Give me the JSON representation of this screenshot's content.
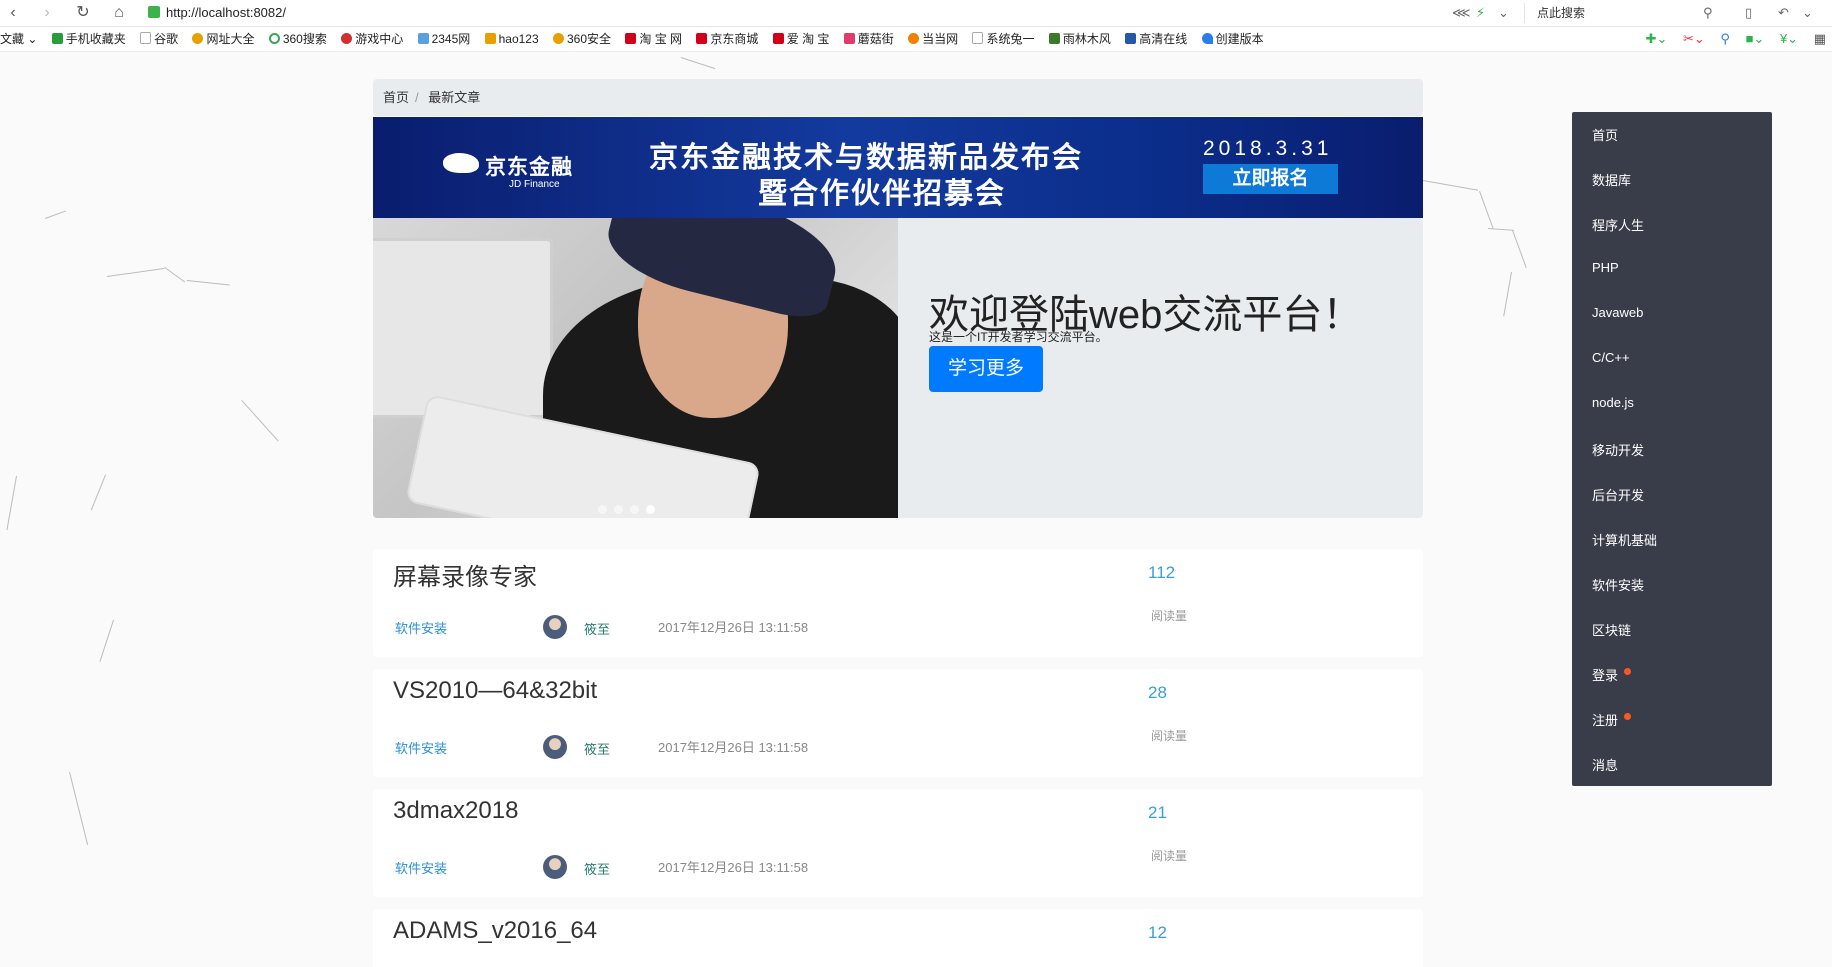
{
  "browser": {
    "url": "http://localhost:8082/",
    "search_placeholder": "点此搜索",
    "bookmarks": [
      "文藏",
      "手机收藏夹",
      "谷歌",
      "网址大全",
      "360搜索",
      "游戏中心",
      "2345网",
      "hao123",
      "360安全",
      "淘 宝 网",
      "京东商城",
      "爱 淘 宝",
      "蘑菇街",
      "当当网",
      "系统兔一",
      "雨林木风",
      "高清在线",
      "创建版本"
    ],
    "bookmark_colors": [
      "#c00",
      "#2a9d3b",
      "#999",
      "#e6a100",
      "#36a852",
      "#d32f2f",
      "#5aa0e0",
      "#e8a000",
      "#e6a100",
      "#d0021b",
      "#d0021b",
      "#d0021b",
      "#e03a6e",
      "#f08000",
      "#999",
      "#3a7a2a",
      "#2457a8",
      "#2b7de9"
    ]
  },
  "breadcrumb": {
    "home": "首页",
    "current": "最新文章"
  },
  "banner": {
    "logo": "京东金融",
    "logo_en": "JD Finance",
    "line1": "京东金融技术与数据新品发布会",
    "line2": "暨合作伙伴招募会",
    "date": "2018.3.31",
    "button": "立即报名"
  },
  "hero": {
    "title": "欢迎登陆web交流平台！",
    "subtitle": "这是一个IT开发者学习交流平台。",
    "button": "学习更多"
  },
  "articles": [
    {
      "title": "屏幕录像专家",
      "category": "软件安装",
      "author": "筱至",
      "time": "2017年12月26日 13:11:58",
      "reads": "112",
      "reads_label": "阅读量"
    },
    {
      "title": "VS2010—64&32bit",
      "category": "软件安装",
      "author": "筱至",
      "time": "2017年12月26日 13:11:58",
      "reads": "28",
      "reads_label": "阅读量"
    },
    {
      "title": "3dmax2018",
      "category": "软件安装",
      "author": "筱至",
      "time": "2017年12月26日 13:11:58",
      "reads": "21",
      "reads_label": "阅读量"
    },
    {
      "title": "ADAMS_v2016_64",
      "category": "",
      "author": "",
      "time": "",
      "reads": "12",
      "reads_label": ""
    }
  ],
  "sidebar": {
    "items": [
      "首页",
      "数据库",
      "程序人生",
      "PHP",
      "Javaweb",
      "C/C++",
      "node.js",
      "移动开发",
      "后台开发",
      "计算机基础",
      "软件安装",
      "区块链",
      "登录",
      "注册",
      "消息"
    ],
    "badge_color": "#ff5722",
    "bg_color": "#393d49"
  }
}
